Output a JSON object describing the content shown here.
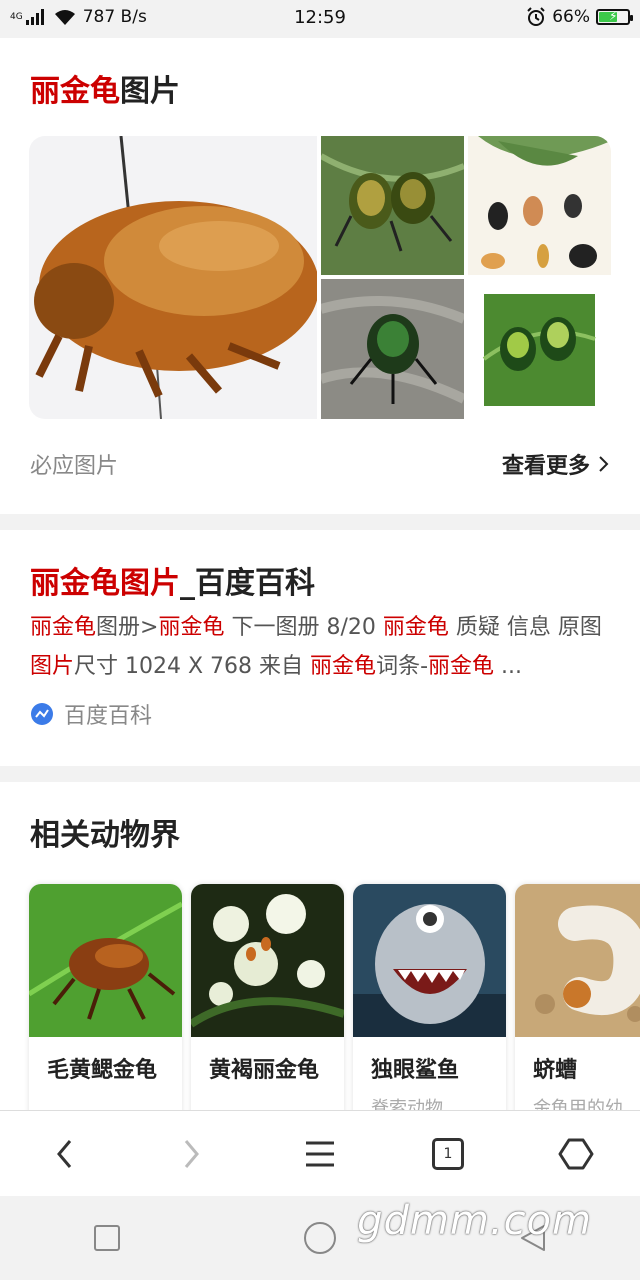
{
  "status_bar": {
    "network": "4G",
    "speed": "787 B/s",
    "time": "12:59",
    "battery": "66%",
    "battery_level": 0.66
  },
  "image_section": {
    "title_highlight": "丽金龟",
    "title_rest": "图片",
    "source_label": "必应图片",
    "more_label": "查看更多"
  },
  "baike_result": {
    "title_highlight": "丽金龟图片",
    "title_rest": "_百度百科",
    "snippet": [
      {
        "t": "丽金龟",
        "hl": true
      },
      {
        "t": "图册>",
        "hl": false
      },
      {
        "t": "丽金龟",
        "hl": true
      },
      {
        "t": " 下一图册 8/20 ",
        "hl": false
      },
      {
        "t": "丽金龟",
        "hl": true
      },
      {
        "t": " 质疑 信息 原图 ",
        "hl": false
      },
      {
        "t": "图片",
        "hl": true
      },
      {
        "t": "尺寸 1024 X 768 来自 ",
        "hl": false
      },
      {
        "t": "丽金龟",
        "hl": true
      },
      {
        "t": "词条-",
        "hl": false
      },
      {
        "t": "丽金龟",
        "hl": true
      },
      {
        "t": " ...",
        "hl": false
      }
    ],
    "source": "百度百科"
  },
  "related": {
    "title": "相关动物界",
    "items": [
      {
        "name": "毛黄鳃金龟",
        "sub": ""
      },
      {
        "name": "黄褐丽金龟",
        "sub": ""
      },
      {
        "name": "独眼鲨鱼",
        "sub": "脊索动物"
      },
      {
        "name": "蛴螬",
        "sub": "金龟甲的幼"
      }
    ]
  },
  "browser_nav": {
    "tab_count": "1",
    "icons": [
      "back-icon",
      "forward-icon",
      "menu-icon",
      "tabs-icon",
      "home-icon"
    ]
  },
  "system_nav": {
    "icons": [
      "recent-apps-icon",
      "home-circle-icon",
      "back-triangle-icon"
    ]
  },
  "watermark": "gdmm.com",
  "colors": {
    "highlight_red": "#cc0000",
    "battery_green": "#3cc84a"
  }
}
